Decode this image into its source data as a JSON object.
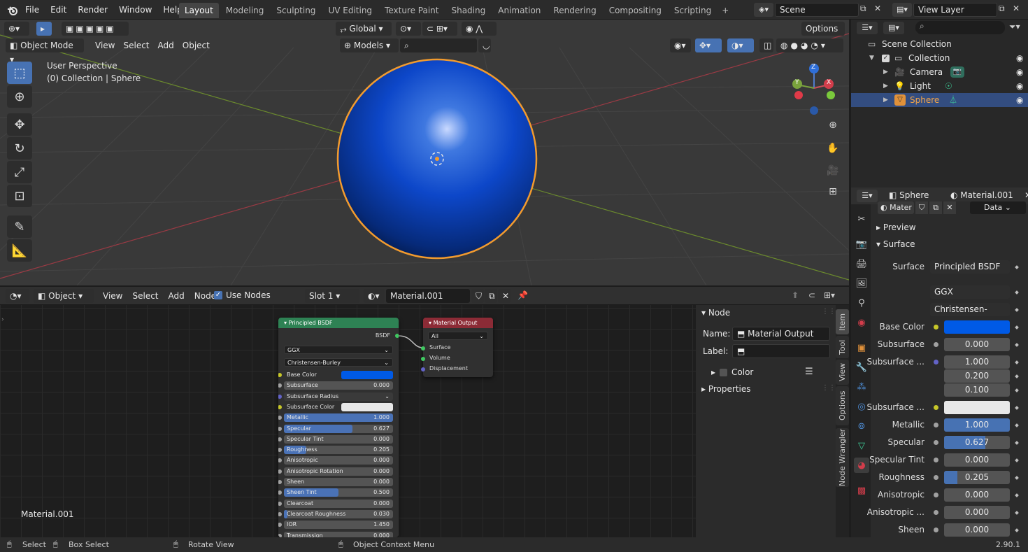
{
  "topbar": {
    "menus": [
      "File",
      "Edit",
      "Render",
      "Window",
      "Help"
    ],
    "workspaces": [
      "Layout",
      "Modeling",
      "Sculpting",
      "UV Editing",
      "Texture Paint",
      "Shading",
      "Animation",
      "Rendering",
      "Compositing",
      "Scripting"
    ],
    "active_workspace": "Layout",
    "scene": "Scene",
    "view_layer": "View Layer"
  },
  "viewport": {
    "transform_orientation": "Global",
    "options_label": "Options",
    "mode": "Object Mode",
    "menus": [
      "View",
      "Select",
      "Add",
      "Object"
    ],
    "models_label": "Models",
    "overlay_title": "User Perspective",
    "overlay_subtitle": "(0) Collection | Sphere",
    "gizmo": {
      "z": "Z",
      "x": "X",
      "y": "Y"
    }
  },
  "outliner": {
    "root": "Scene Collection",
    "collection": "Collection",
    "items": [
      "Camera",
      "Light",
      "Sphere"
    ],
    "selected": "Sphere"
  },
  "properties": {
    "object": "Sphere",
    "material": "Material.001",
    "mat_short": "Mater",
    "data_label": "Data",
    "panels": {
      "preview": "Preview",
      "surface": "Surface"
    },
    "rows": [
      {
        "label": "Surface",
        "value": "Principled BSDF"
      },
      {
        "label": "",
        "value": "GGX"
      },
      {
        "label": "",
        "value": "Christensen-Burley"
      },
      {
        "label": "Base Color",
        "value": ""
      },
      {
        "label": "Subsurface",
        "value": "0.000"
      },
      {
        "label": "Subsurface ...",
        "values": [
          "1.000",
          "0.200",
          "0.100"
        ]
      },
      {
        "label": "Subsurface ...",
        "value": ""
      },
      {
        "label": "Metallic",
        "value": "1.000",
        "fill": 1.0
      },
      {
        "label": "Specular",
        "value": "0.627",
        "fill": 0.627
      },
      {
        "label": "Specular Tint",
        "value": "0.000"
      },
      {
        "label": "Roughness",
        "value": "0.205",
        "fill": 0.205
      },
      {
        "label": "Anisotropic",
        "value": "0.000"
      },
      {
        "label": "Anisotropic ...",
        "value": "0.000"
      },
      {
        "label": "Sheen",
        "value": "0.000"
      }
    ]
  },
  "node_editor": {
    "type": "Object",
    "menus": [
      "View",
      "Select",
      "Add",
      "Node"
    ],
    "use_nodes": "Use Nodes",
    "slot": "Slot 1",
    "material": "Material.001",
    "footer_label": "Material.001",
    "principled": {
      "title": "Principled BSDF",
      "output": "BSDF",
      "distribution": "GGX",
      "subsurface_method": "Christensen-Burley",
      "rows": [
        {
          "label": "Base Color",
          "type": "color"
        },
        {
          "label": "Subsurface",
          "value": "0.000",
          "fill": 0
        },
        {
          "label": "Subsurface Radius",
          "type": "dropdown"
        },
        {
          "label": "Subsurface Color",
          "type": "color_white"
        },
        {
          "label": "Metallic",
          "value": "1.000",
          "fill": 1.0
        },
        {
          "label": "Specular",
          "value": "0.627",
          "fill": 0.627
        },
        {
          "label": "Specular Tint",
          "value": "0.000",
          "fill": 0
        },
        {
          "label": "Roughness",
          "value": "0.205",
          "fill": 0.205
        },
        {
          "label": "Anisotropic",
          "value": "0.000",
          "fill": 0
        },
        {
          "label": "Anisotropic Rotation",
          "value": "0.000",
          "fill": 0
        },
        {
          "label": "Sheen",
          "value": "0.000",
          "fill": 0
        },
        {
          "label": "Sheen Tint",
          "value": "0.500",
          "fill": 0.5
        },
        {
          "label": "Clearcoat",
          "value": "0.000",
          "fill": 0
        },
        {
          "label": "Clearcoat Roughness",
          "value": "0.030",
          "fill": 0.03
        },
        {
          "label": "IOR",
          "value": "1.450",
          "fill": 0
        },
        {
          "label": "Transmission",
          "value": "0.000",
          "fill": 0
        }
      ]
    },
    "output_node": {
      "title": "Material Output",
      "target": "All",
      "inputs": [
        "Surface",
        "Volume",
        "Displacement"
      ]
    },
    "sidebar": {
      "section": "Node",
      "name_label": "Name:",
      "name_value": "Material Output",
      "label_label": "Label:",
      "color_label": "Color",
      "properties_label": "Properties",
      "tabs": [
        "Item",
        "Tool",
        "View",
        "Options",
        "Node Wrangler"
      ]
    }
  },
  "statusbar": {
    "select": "Select",
    "box_select": "Box Select",
    "rotate": "Rotate View",
    "context": "Object Context Menu",
    "version": "2.90.1"
  },
  "colors": {
    "accent": "#4772b3",
    "selection_orange": "#f29b2e",
    "base_color": "#005ae6"
  }
}
